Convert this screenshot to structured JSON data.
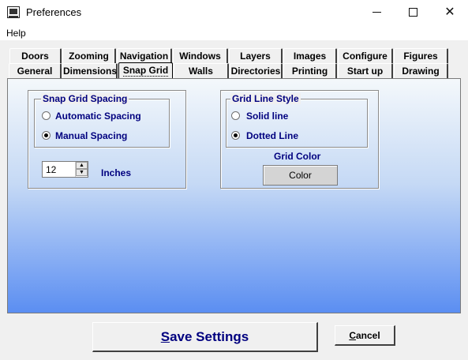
{
  "window": {
    "title": "Preferences",
    "minimize": "",
    "maximize": "",
    "close": "✕"
  },
  "menu": {
    "help": "Help"
  },
  "tabs": {
    "row1": [
      "Doors",
      "Zooming",
      "Navigation",
      "Windows",
      "Layers",
      "Images",
      "Configure",
      "Figures"
    ],
    "row2": [
      "General",
      "Dimensions",
      "Snap Grid",
      "Walls",
      "Directories",
      "Printing",
      "Start up",
      "Drawing"
    ],
    "selected": "Snap Grid"
  },
  "snap_grid": {
    "title": "Snap Grid Spacing",
    "options": [
      {
        "label": "Automatic Spacing",
        "checked": false
      },
      {
        "label": "Manual Spacing",
        "checked": true
      }
    ],
    "spacing_value": "12",
    "unit_label": "Inches"
  },
  "grid_line": {
    "title": "Grid Line Style",
    "options": [
      {
        "label": "Solid line",
        "checked": false
      },
      {
        "label": "Dotted Line",
        "checked": true
      }
    ],
    "color_label": "Grid Color",
    "color_button": "Color"
  },
  "buttons": {
    "save": "Save Settings",
    "cancel": "Cancel"
  },
  "colors": {
    "accent_text": "#00007f",
    "gradient_top": "#f4f8fb",
    "gradient_bottom": "#5b8ef2"
  }
}
